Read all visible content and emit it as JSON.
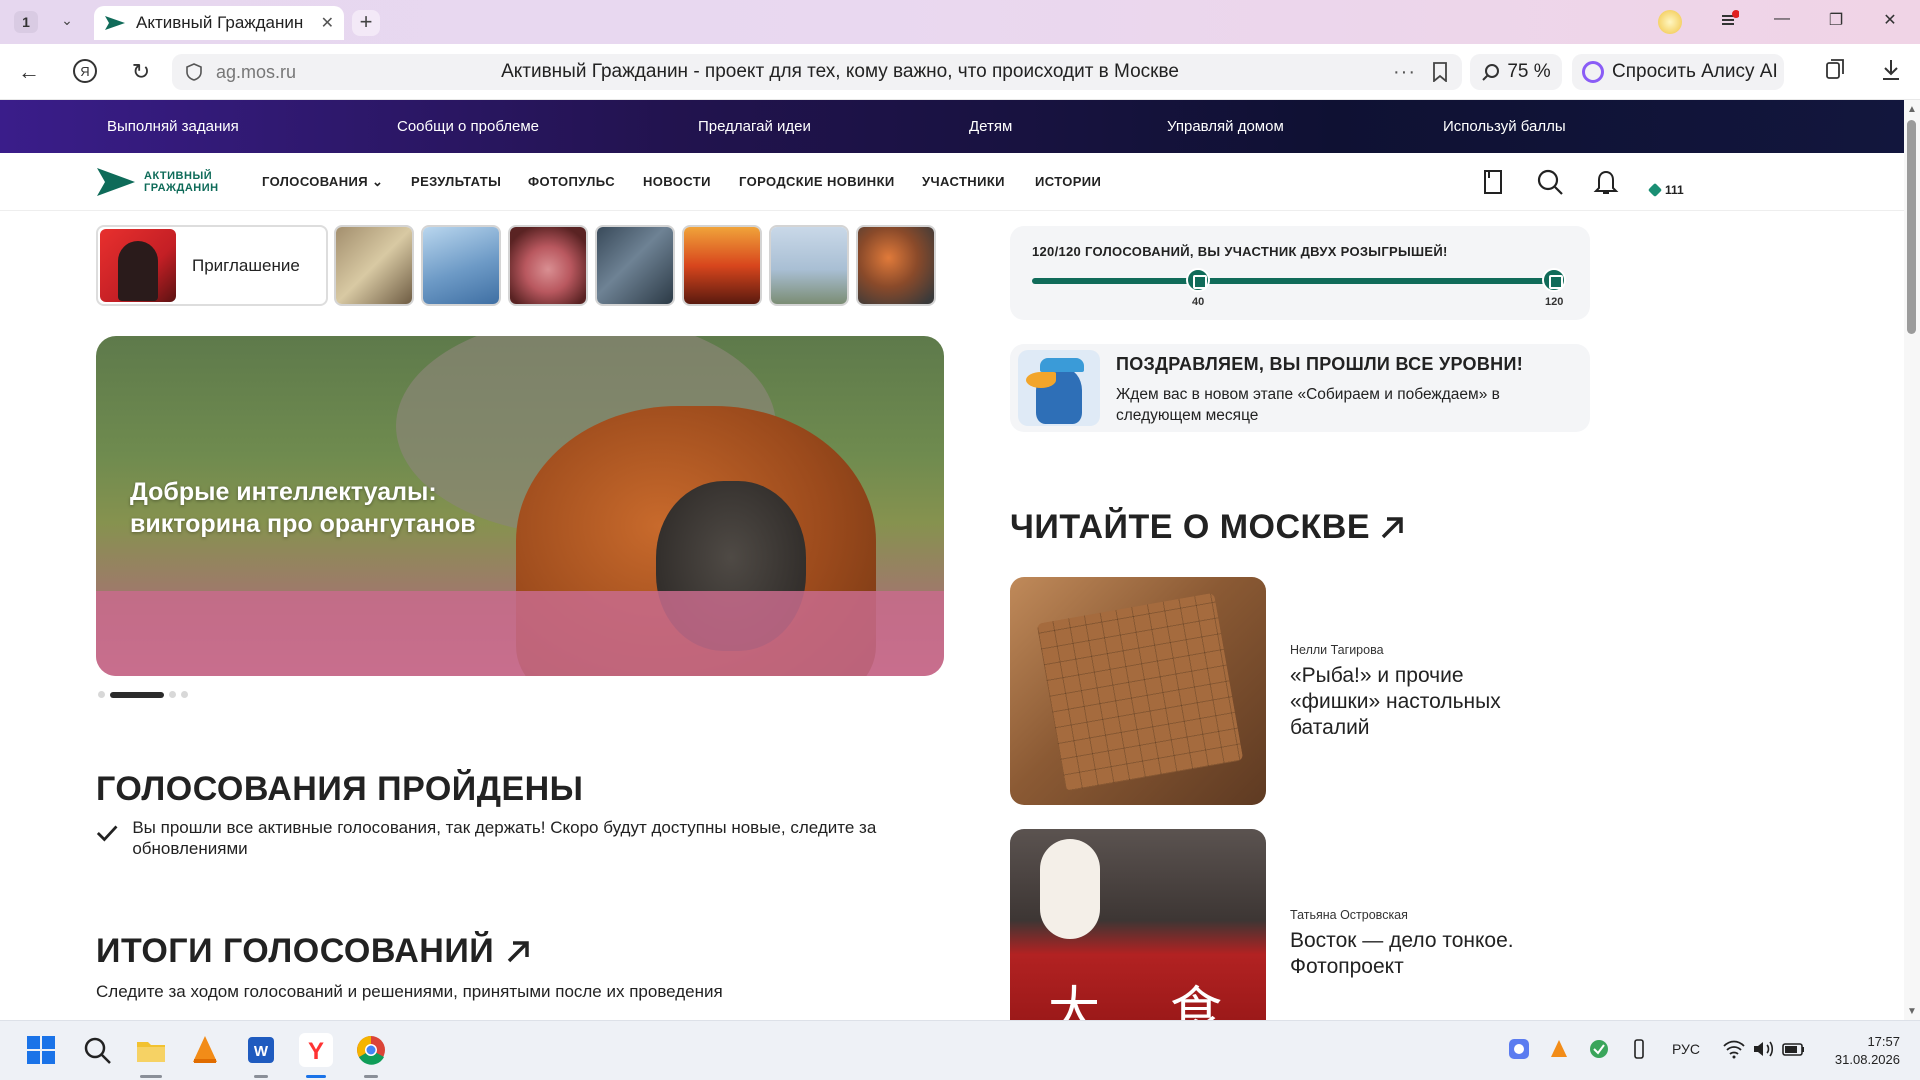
{
  "browser": {
    "tab_count": "1",
    "tab_title": "Активный Гражданин",
    "url": "ag.mos.ru",
    "page_title": "Активный Гражданин - проект для тех, кому важно, что происходит в Москве",
    "zoom": "75 %",
    "alice_label": "Спросить Алису AI"
  },
  "topstrip": {
    "items": [
      "Выполняй задания",
      "Сообщи о проблеме",
      "Предлагай идеи",
      "Детям",
      "Управляй домом",
      "Используй баллы"
    ]
  },
  "nav": {
    "logo_line1": "АКТИВНЫЙ",
    "logo_line2": "ГРАЖДАНИН",
    "items": [
      "ГОЛОСОВАНИЯ",
      "РЕЗУЛЬТАТЫ",
      "ФОТОПУЛЬС",
      "НОВОСТИ",
      "ГОРОДСКИЕ НОВИНКИ",
      "УЧАСТНИКИ",
      "ИСТОРИИ"
    ],
    "points": "111"
  },
  "stories": {
    "first_label": "Приглашение"
  },
  "hero": {
    "title": "Добрые интеллектуалы: викторина про орангутанов",
    "slides_total": 4,
    "active_slide": 2
  },
  "votes_done": {
    "title": "ГОЛОСОВАНИЯ ПРОЙДЕНЫ",
    "text": "Вы прошли все активные голосования, так держать! Скоро будут доступны новые, следите за обновлениями"
  },
  "results": {
    "title": "ИТОГИ ГОЛОСОВАНИЙ",
    "subtitle": "Следите за ходом голосований и решениями, принятыми после их проведения"
  },
  "progress": {
    "title": "120/120 ГОЛОСОВАНИЙ, ВЫ УЧАСТНИК ДВУХ РОЗЫГРЫШЕЙ!",
    "value": 120,
    "max": 120,
    "milestones": [
      "40",
      "120"
    ]
  },
  "congrats": {
    "title": "ПОЗДРАВЛЯЕМ, ВЫ ПРОШЛИ ВСЕ УРОВНИ!",
    "text": "Ждем вас в новом этапе «Собираем и побеждаем» в следующем месяце"
  },
  "read": {
    "title": "ЧИТАЙТЕ О МОСКВЕ",
    "articles": [
      {
        "author": "Нелли Тагирова",
        "title": "«Рыба!» и прочие «фишки» настольных баталий"
      },
      {
        "author": "Татьяна Островская",
        "title": "Восток — дело тонкое. Фотопроект"
      }
    ]
  },
  "taskbar": {
    "lang": "РУС",
    "time": "17:57",
    "date": "31.08.2026"
  },
  "colors": {
    "brand_green": "#106b59",
    "strip_start": "#3a1d8a",
    "strip_end": "#12163d"
  }
}
